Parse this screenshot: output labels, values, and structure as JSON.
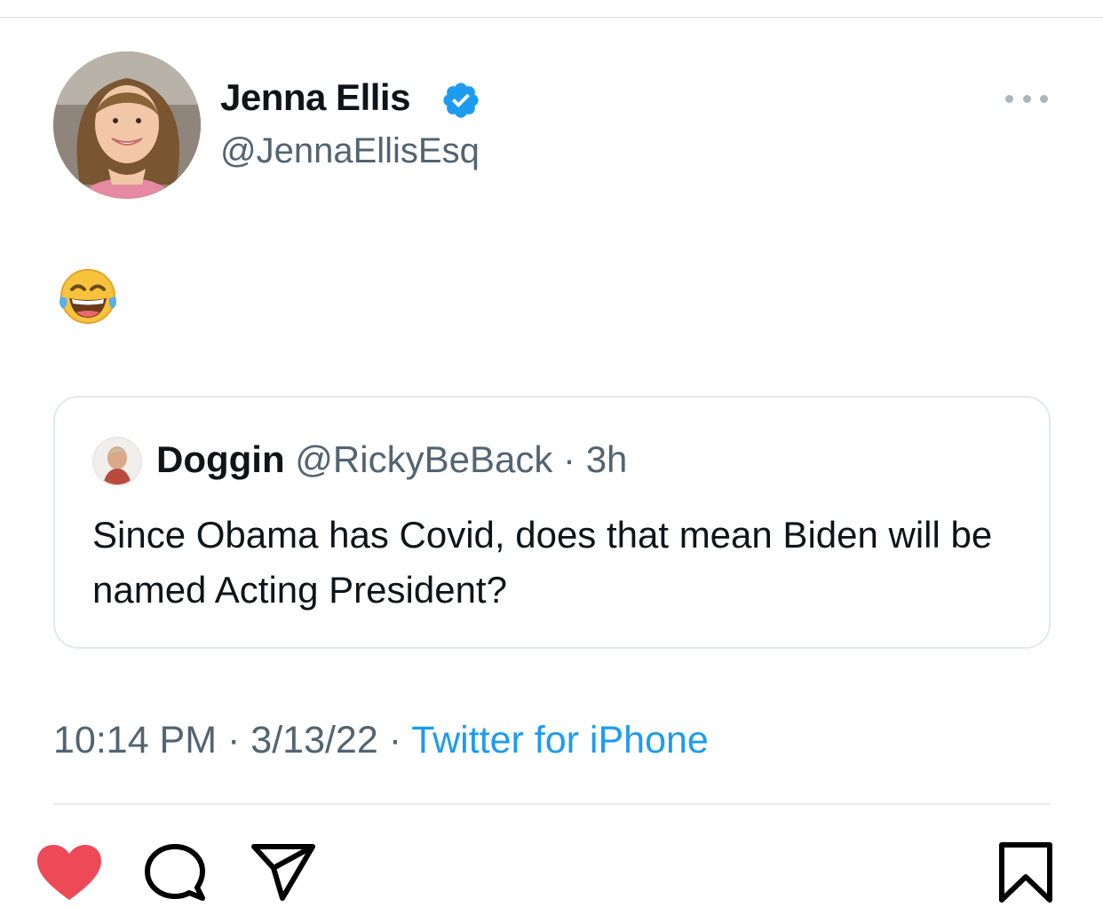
{
  "author": {
    "display_name": "Jenna Ellis",
    "handle": "@JennaEllisEsq",
    "verified": true,
    "avatar": "profile-photo"
  },
  "tweet": {
    "emoji": "😂",
    "emoji_name": "face-with-tears-of-joy"
  },
  "quoted_tweet": {
    "display_name": "Doggin",
    "handle": "@RickyBeBack",
    "separator": "·",
    "time_ago": "3h",
    "text": "Since Obama has Covid, does that mean Biden will be named Acting President?"
  },
  "meta": {
    "time": "10:14 PM",
    "separator": "·",
    "date": "3/13/22",
    "source": "Twitter for iPhone"
  },
  "actions": [
    "heart-icon",
    "comment-icon",
    "share-icon",
    "bookmark-icon"
  ],
  "colors": {
    "verified_blue": "#1d9bf0",
    "like_red": "#ed4956",
    "secondary_text": "#536471",
    "link_blue": "#1d9bf0"
  }
}
